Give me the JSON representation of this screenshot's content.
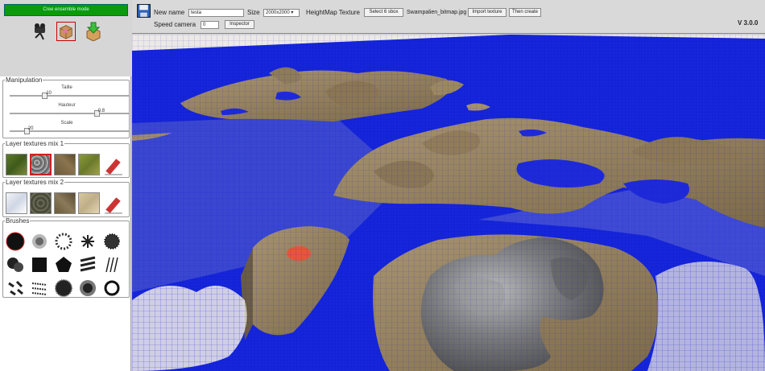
{
  "sidebar": {
    "mode_button": "Cree ensemble mode",
    "tools": [
      "camera-icon",
      "cube-box-icon",
      "download-icon"
    ],
    "manipulation": {
      "legend": "Manipulation",
      "sliders": [
        {
          "label": "Taille",
          "value": "10",
          "level": 0.28
        },
        {
          "label": "Hauteur",
          "value": "0.8",
          "level": 0.74
        },
        {
          "label": "Scale",
          "value": "20",
          "level": 0.12
        }
      ]
    },
    "layer1": {
      "legend": "Layer textures mix 1",
      "textures": [
        "grass-texture",
        "rock-texture",
        "dirt-texture",
        "moss-texture"
      ],
      "erase_icon": "eraser-icon"
    },
    "layer2": {
      "legend": "Layer textures mix 2",
      "textures": [
        "snow-texture",
        "stone-texture",
        "mud-texture",
        "sand-texture"
      ],
      "erase_icon": "eraser-icon"
    },
    "brushes": {
      "legend": "Brushes",
      "items": [
        "round-brush",
        "soft-brush",
        "noise-brush",
        "splatter-brush",
        "spray-brush",
        "cloud-brush",
        "square-brush",
        "pentagon-brush",
        "stripes-brush",
        "lines-brush",
        "leaf-brush",
        "scratch-brush",
        "blob-brush",
        "radial-brush",
        "ring-brush"
      ]
    }
  },
  "header": {
    "save_icon": "save-icon",
    "new_name_label": "New name",
    "new_name_value": "testa",
    "size_label": "Size",
    "size_value": "2000x2000 ▾",
    "heightmap_label": "HeightMap Texture",
    "select_button": "Select 6 sbox",
    "heightmap_file": "Swampalien_bitmap.jpg",
    "import_button": "Import texture",
    "create_button": "Then create",
    "speed_label": "Speed camera",
    "speed_value": "0",
    "inspector_button": "Inspector",
    "version": "V 3.0.0"
  },
  "viewport": {
    "name": "terrain-3d-view"
  },
  "colors": {
    "accent": "#0a9a0a",
    "water": "#0b18d6",
    "sand": "#9b8561",
    "rock": "#8a8a8a",
    "cursor": "#e8553a"
  }
}
